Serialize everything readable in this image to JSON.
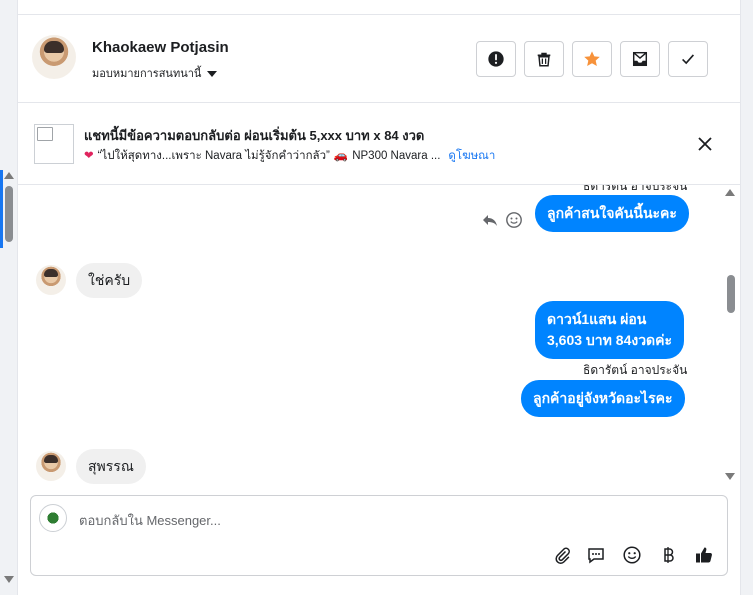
{
  "header": {
    "contact_name": "Khaokaew Potjasin",
    "assign_label": "มอบหมายการสนทนานี้",
    "actions": [
      {
        "name": "mark-spam-button",
        "icon": "alert-circle-icon"
      },
      {
        "name": "delete-button",
        "icon": "trash-icon"
      },
      {
        "name": "star-button",
        "icon": "star-icon",
        "color": "#f7923a"
      },
      {
        "name": "mark-unread-button",
        "icon": "envelope-icon"
      },
      {
        "name": "mark-done-button",
        "icon": "check-icon"
      }
    ]
  },
  "ad": {
    "title": "แชทนี้มีข้อความตอบกลับต่อ ผ่อนเริ่มต้น 5,xxx บาท x 84 งวด",
    "subtitle": "“ไปให้สุดทาง...เพราะ Navara ไม่รู้จักคำว่ากลัว”",
    "subtitle_product": "NP300 Navara ...",
    "link_label": "ดูโฆษณา"
  },
  "messages": {
    "partial_sender": "ธิดารัตน์ อาจประจัน",
    "msg1": "ลูกค้าสนใจคันนี้นะคะ",
    "msg2": "ใช่ครับ",
    "msg3_line1": "ดาวน์1แสน ผ่อน",
    "msg3_line2": "3,603 บาท 84งวดค่ะ",
    "msg3_sender": "ธิดารัตน์ อาจประจัน",
    "msg4": "ลูกค้าอยู่จังหวัดอะไรคะ",
    "msg5": "สุพรรณ"
  },
  "composer": {
    "placeholder": "ตอบกลับใน Messenger...",
    "tools": [
      "attachment-icon",
      "saved-replies-icon",
      "emoji-icon",
      "baht-payment-icon",
      "thumbs-up-icon"
    ]
  },
  "colors": {
    "accent": "#0084ff",
    "link": "#1877f2",
    "star": "#f7923a",
    "incoming_bubble": "#f0f0f0"
  }
}
